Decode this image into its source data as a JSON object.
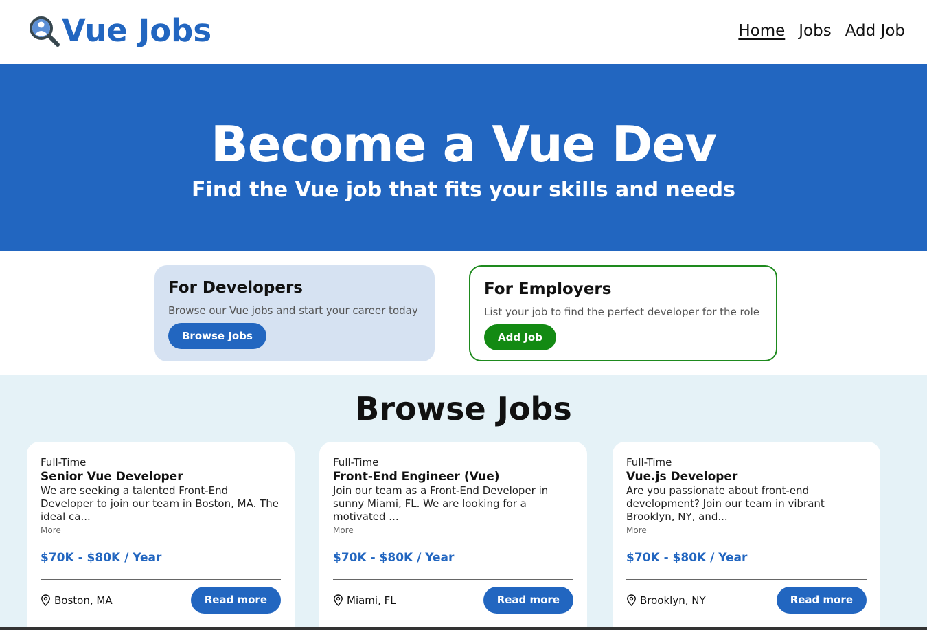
{
  "header": {
    "brand": "Vue Jobs",
    "logo_icon": "search-person-icon",
    "nav": [
      {
        "label": "Home",
        "active": true
      },
      {
        "label": "Jobs",
        "active": false
      },
      {
        "label": "Add Job",
        "active": false
      }
    ]
  },
  "hero": {
    "title": "Become a Vue Dev",
    "subtitle": "Find the Vue job that fits your skills and needs"
  },
  "developers": {
    "title": "For Developers",
    "description": "Browse our Vue jobs and start your career today",
    "button": "Browse Jobs"
  },
  "employers": {
    "title": "For Employers",
    "description": "List your job to find the perfect developer for the role",
    "button": "Add Job"
  },
  "browse": {
    "title": "Browse Jobs",
    "jobs": [
      {
        "type": "Full-Time",
        "title": "Senior Vue Developer",
        "description": "We are seeking a talented Front-End Developer to join our team in Boston, MA. The ideal ca...",
        "more": "More",
        "salary": "$70K - $80K / Year",
        "location": "Boston, MA",
        "button": "Read more"
      },
      {
        "type": "Full-Time",
        "title": "Front-End Engineer (Vue)",
        "description": "Join our team as a Front-End Developer in sunny Miami, FL. We are looking for a motivated ...",
        "more": "More",
        "salary": "$70K - $80K / Year",
        "location": "Miami, FL",
        "button": "Read more"
      },
      {
        "type": "Full-Time",
        "title": "Vue.js Developer",
        "description": "Are you passionate about front-end development? Join our team in vibrant Brooklyn, NY, and...",
        "more": "More",
        "salary": "$70K - $80K / Year",
        "location": "Brooklyn, NY",
        "button": "Read more"
      }
    ]
  },
  "colors": {
    "primary": "#2266c0",
    "success": "#138a13",
    "dev_card_bg": "#d6e2f2",
    "browse_bg": "#e5f2f7"
  }
}
